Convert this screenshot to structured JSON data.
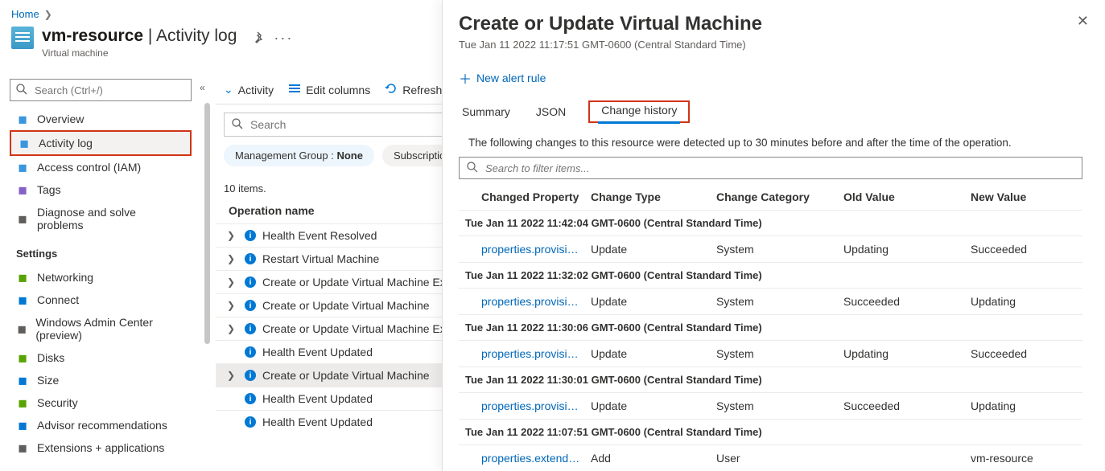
{
  "breadcrumb": {
    "home": "Home"
  },
  "header": {
    "title": "vm-resource",
    "divider": " | ",
    "title2": "Activity log",
    "subtitle": "Virtual machine"
  },
  "sidebar": {
    "search_ph": "Search (Ctrl+/)",
    "items": [
      {
        "label": "Overview",
        "icon": "monitor-icon",
        "color": "#3a96dd"
      },
      {
        "label": "Activity log",
        "icon": "log-icon",
        "color": "#3a96dd",
        "selected": true
      },
      {
        "label": "Access control (IAM)",
        "icon": "people-icon",
        "color": "#3a96dd"
      },
      {
        "label": "Tags",
        "icon": "tag-icon",
        "color": "#8661c5"
      },
      {
        "label": "Diagnose and solve problems",
        "icon": "wrench-icon",
        "color": "#605e5c"
      }
    ],
    "section": "Settings",
    "settings": [
      {
        "label": "Networking",
        "icon": "network-icon",
        "color": "#57a300"
      },
      {
        "label": "Connect",
        "icon": "connect-icon",
        "color": "#0078d4"
      },
      {
        "label": "Windows Admin Center (preview)",
        "icon": "wac-icon",
        "color": "#605e5c"
      },
      {
        "label": "Disks",
        "icon": "disk-icon",
        "color": "#57a300"
      },
      {
        "label": "Size",
        "icon": "size-icon",
        "color": "#0078d4"
      },
      {
        "label": "Security",
        "icon": "shield-icon",
        "color": "#57a300"
      },
      {
        "label": "Advisor recommendations",
        "icon": "advisor-icon",
        "color": "#0078d4"
      },
      {
        "label": "Extensions + applications",
        "icon": "ext-icon",
        "color": "#605e5c"
      }
    ]
  },
  "toolbar": {
    "activity": "Activity",
    "edit": "Edit columns",
    "refresh": "Refresh"
  },
  "middle": {
    "search_ph": "Search",
    "pill1_key": "Management Group : ",
    "pill1_val": "None",
    "pill2": "Subscription",
    "count": "10 items.",
    "col": "Operation name",
    "ops": [
      {
        "label": "Health Event Resolved",
        "caret": true
      },
      {
        "label": "Restart Virtual Machine",
        "caret": true
      },
      {
        "label": "Create or Update Virtual Machine Extension",
        "caret": true
      },
      {
        "label": "Create or Update Virtual Machine",
        "caret": true
      },
      {
        "label": "Create or Update Virtual Machine Extension",
        "caret": true
      },
      {
        "label": "Health Event Updated",
        "caret": false
      },
      {
        "label": "Create or Update Virtual Machine",
        "caret": true,
        "selected": true
      },
      {
        "label": "Health Event Updated",
        "caret": false
      },
      {
        "label": "Health Event Updated",
        "caret": false
      }
    ]
  },
  "panel": {
    "title": "Create or Update Virtual Machine",
    "ts": "Tue Jan 11 2022 11:17:51 GMT-0600 (Central Standard Time)",
    "newrule": "New alert rule",
    "tabs": {
      "summary": "Summary",
      "json": "JSON",
      "history": "Change history"
    },
    "desc": "The following changes to this resource were detected up to 30 minutes before and after the time of the operation.",
    "filter_ph": "Search to filter items...",
    "cols": {
      "c1": "Changed Property",
      "c2": "Change Type",
      "c3": "Change Category",
      "c4": "Old Value",
      "c5": "New Value"
    },
    "groups": [
      {
        "ts": "Tue Jan 11 2022 11:42:04 GMT-0600 (Central Standard Time)",
        "rows": [
          {
            "prop": "properties.provision…",
            "type": "Update",
            "cat": "System",
            "old": "Updating",
            "new": "Succeeded"
          }
        ]
      },
      {
        "ts": "Tue Jan 11 2022 11:32:02 GMT-0600 (Central Standard Time)",
        "rows": [
          {
            "prop": "properties.provision…",
            "type": "Update",
            "cat": "System",
            "old": "Succeeded",
            "new": "Updating"
          }
        ]
      },
      {
        "ts": "Tue Jan 11 2022 11:30:06 GMT-0600 (Central Standard Time)",
        "rows": [
          {
            "prop": "properties.provision…",
            "type": "Update",
            "cat": "System",
            "old": "Updating",
            "new": "Succeeded"
          }
        ]
      },
      {
        "ts": "Tue Jan 11 2022 11:30:01 GMT-0600 (Central Standard Time)",
        "rows": [
          {
            "prop": "properties.provision…",
            "type": "Update",
            "cat": "System",
            "old": "Succeeded",
            "new": "Updating"
          }
        ]
      },
      {
        "ts": "Tue Jan 11 2022 11:07:51 GMT-0600 (Central Standard Time)",
        "rows": [
          {
            "prop": "properties.extended…",
            "type": "Add",
            "cat": "User",
            "old": "",
            "new": "vm-resource"
          }
        ]
      }
    ]
  }
}
